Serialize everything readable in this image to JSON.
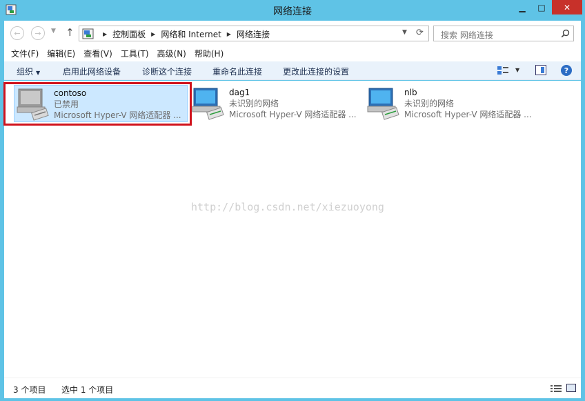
{
  "window": {
    "title": "网络连接"
  },
  "title_buttons": {
    "minimize": "▁",
    "maximize": "□",
    "close": "✕"
  },
  "address": {
    "crumbs": [
      "控制面板",
      "网络和 Internet",
      "网络连接"
    ]
  },
  "search": {
    "placeholder": "搜索 网络连接"
  },
  "menu": [
    "文件(F)",
    "编辑(E)",
    "查看(V)",
    "工具(T)",
    "高级(N)",
    "帮助(H)"
  ],
  "commands": {
    "organize": "组织",
    "enable": "启用此网络设备",
    "diagnose": "诊断这个连接",
    "rename": "重命名此连接",
    "change": "更改此连接的设置"
  },
  "connections": [
    {
      "name": "contoso",
      "status": "已禁用",
      "adapter": "Microsoft Hyper-V 网络适配器 ...",
      "icon": "network-adapter-disabled-icon",
      "selected": true
    },
    {
      "name": "dag1",
      "status": "未识别的网络",
      "adapter": "Microsoft Hyper-V 网络适配器 ...",
      "icon": "network-adapter-icon",
      "selected": false
    },
    {
      "name": "nlb",
      "status": "未识别的网络",
      "adapter": "Microsoft Hyper-V 网络适配器 ...",
      "icon": "network-adapter-icon",
      "selected": false
    }
  ],
  "watermark": "http://blog.csdn.net/xiezuoyong",
  "status_bar": {
    "count": "3 个项目",
    "selected": "选中 1 个项目"
  },
  "colors": {
    "titlebar": "#5fc3e6",
    "close": "#c7312a",
    "selection": "#cce8ff",
    "highlight": "#d0121c",
    "commandbar": "#e9f2fb"
  }
}
